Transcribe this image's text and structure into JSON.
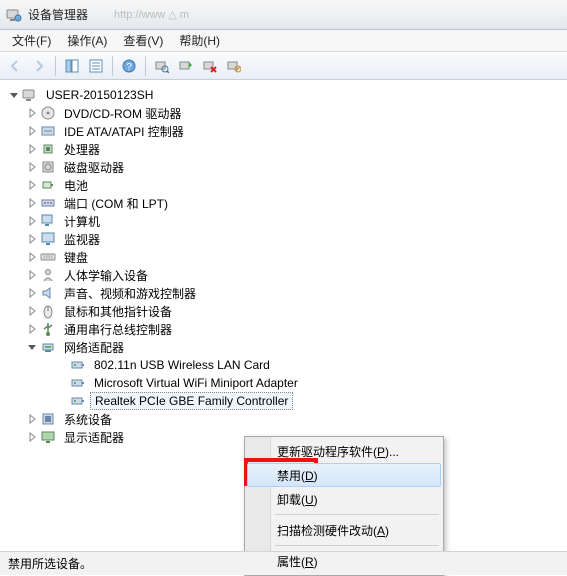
{
  "titlebar": {
    "title": "设备管理器",
    "browser_hint": "http://www  △  m"
  },
  "menus": {
    "file": "文件(F)",
    "action": "操作(A)",
    "view": "查看(V)",
    "help": "帮助(H)"
  },
  "tree": {
    "root": "USER-20150123SH",
    "categories": [
      {
        "label": "DVD/CD-ROM 驱动器",
        "icon": "disc"
      },
      {
        "label": "IDE ATA/ATAPI 控制器",
        "icon": "ide"
      },
      {
        "label": "处理器",
        "icon": "cpu"
      },
      {
        "label": "磁盘驱动器",
        "icon": "disk"
      },
      {
        "label": "电池",
        "icon": "battery"
      },
      {
        "label": "端口 (COM 和 LPT)",
        "icon": "port"
      },
      {
        "label": "计算机",
        "icon": "computer"
      },
      {
        "label": "监视器",
        "icon": "monitor"
      },
      {
        "label": "键盘",
        "icon": "keyboard"
      },
      {
        "label": "人体学输入设备",
        "icon": "hid"
      },
      {
        "label": "声音、视频和游戏控制器",
        "icon": "sound"
      },
      {
        "label": "鼠标和其他指针设备",
        "icon": "mouse"
      },
      {
        "label": "通用串行总线控制器",
        "icon": "usb"
      },
      {
        "label": "网络适配器",
        "icon": "network",
        "expanded": true,
        "children": [
          {
            "label": "802.11n USB Wireless LAN Card",
            "icon": "net-adapter"
          },
          {
            "label": "Microsoft Virtual WiFi Miniport Adapter",
            "icon": "net-adapter"
          },
          {
            "label": "Realtek PCIe GBE Family Controller",
            "icon": "net-adapter",
            "selected": true
          }
        ]
      },
      {
        "label": "系统设备",
        "icon": "system"
      },
      {
        "label": "显示适配器",
        "icon": "display"
      }
    ]
  },
  "context_menu": {
    "update_driver": "更新驱动程序软件(P)...",
    "disable": "禁用(D)",
    "uninstall": "卸载(U)",
    "scan": "扫描检测硬件改动(A)",
    "properties": "属性(R)"
  },
  "statusbar": {
    "text": "禁用所选设备。"
  }
}
